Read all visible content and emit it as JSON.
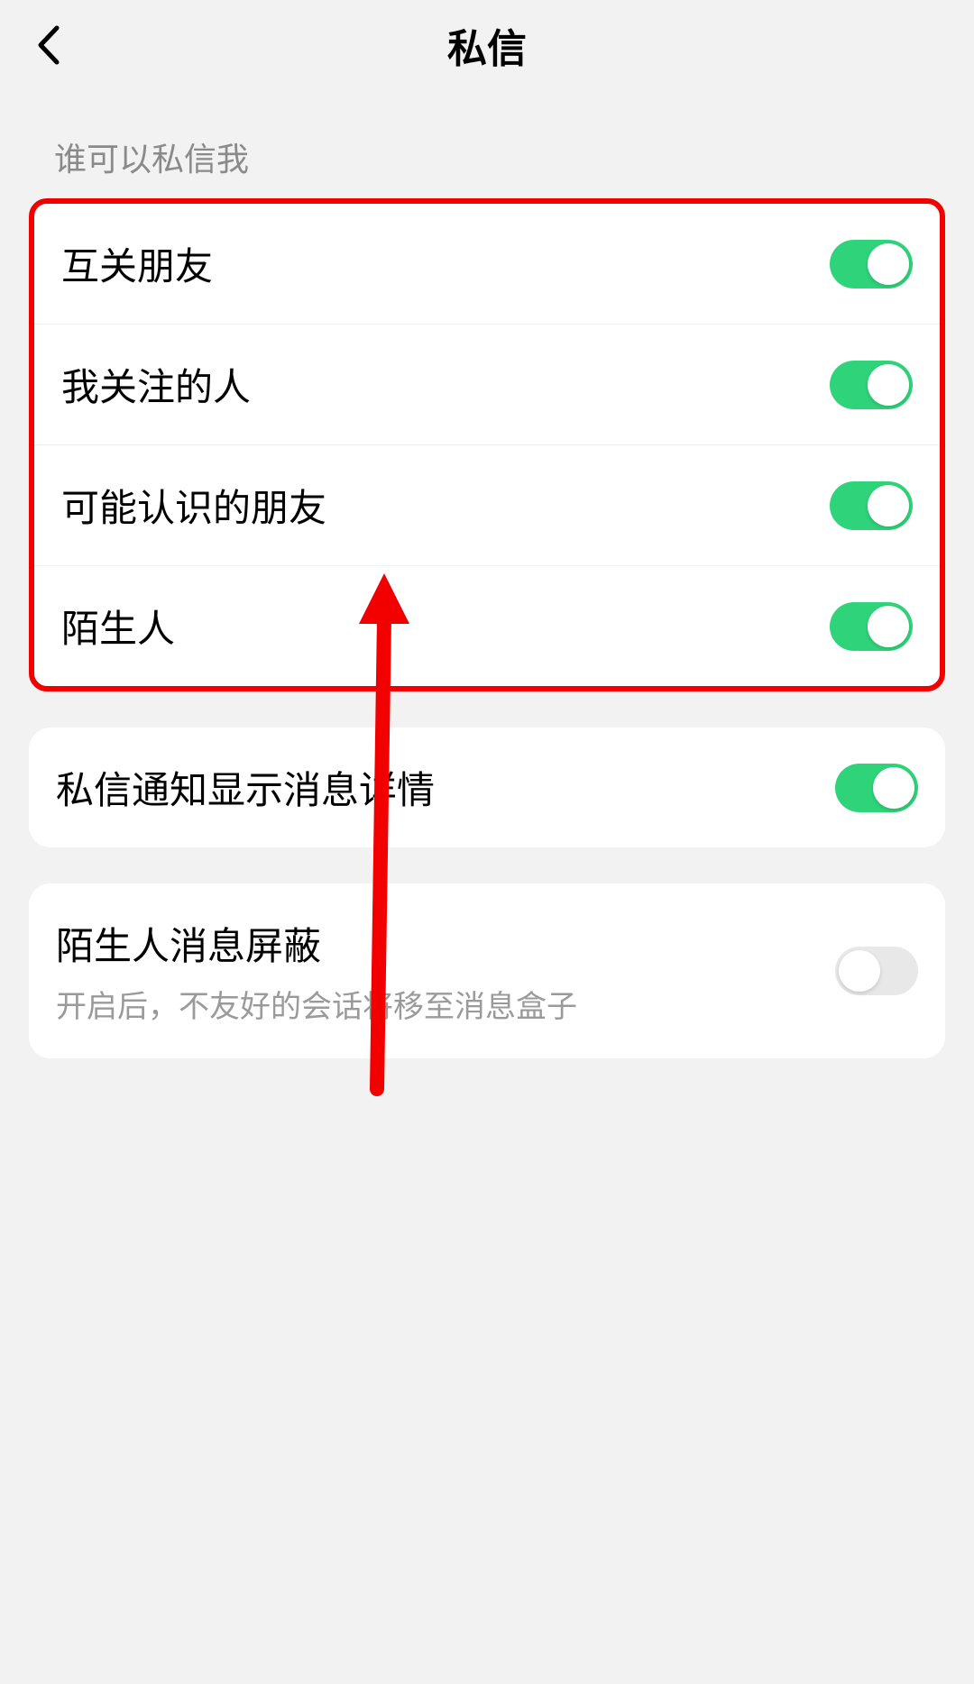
{
  "header": {
    "title": "私信"
  },
  "section1": {
    "label": "谁可以私信我",
    "items": [
      {
        "label": "互关朋友",
        "on": true
      },
      {
        "label": "我关注的人",
        "on": true
      },
      {
        "label": "可能认识的朋友",
        "on": true
      },
      {
        "label": "陌生人",
        "on": true
      }
    ]
  },
  "section2": {
    "items": [
      {
        "label": "私信通知显示消息详情",
        "on": true
      }
    ]
  },
  "section3": {
    "items": [
      {
        "label": "陌生人消息屏蔽",
        "sub": "开启后，不友好的会话将移至消息盒子",
        "on": false
      }
    ]
  },
  "colors": {
    "accent": "#2fd37a",
    "highlight": "#f20000",
    "bg": "#f2f2f2"
  }
}
